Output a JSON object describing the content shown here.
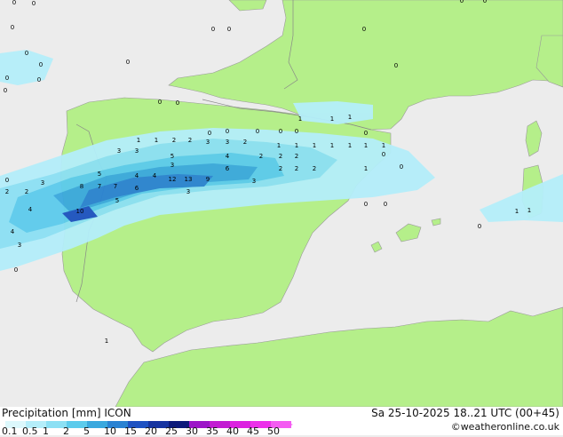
{
  "map": {
    "colors": {
      "sea": "#ececec",
      "land": "#b5ef8a",
      "border": "#999999"
    },
    "precip_labels": [
      "0",
      "0",
      "0",
      "0",
      "0",
      "0",
      "0",
      "0",
      "0",
      "0",
      "0",
      "0",
      "0",
      "0",
      "0",
      "0",
      "0",
      "0",
      "0",
      "0",
      "0",
      "0",
      "0",
      "0",
      "0",
      "0",
      "0",
      "0",
      "0",
      "0",
      "1",
      "1",
      "1",
      "1",
      "1",
      "1",
      "1",
      "1",
      "1",
      "1",
      "1",
      "1",
      "1",
      "1",
      "1",
      "1",
      "2",
      "2",
      "2",
      "2",
      "2",
      "2",
      "2",
      "2",
      "2",
      "2",
      "2",
      "3",
      "3",
      "3",
      "3",
      "3",
      "3",
      "3",
      "3",
      "3",
      "4",
      "4",
      "4",
      "4",
      "4",
      "5",
      "5",
      "5",
      "6",
      "6",
      "7",
      "7",
      "8",
      "9",
      "10",
      "12",
      "13"
    ]
  },
  "footer": {
    "title": "Precipitation [mm]",
    "model": "ICON",
    "datetime": "Sa 25-10-2025 18..21 UTC (00+45)",
    "credit": "©weatheronline.co.uk",
    "scale_labels": [
      "0.1",
      "0.5",
      "1",
      "2",
      "5",
      "10",
      "15",
      "20",
      "25",
      "30",
      "35",
      "40",
      "45",
      "50"
    ],
    "scale_colors": [
      "#dcf8fc",
      "#b4eefa",
      "#8ce0f4",
      "#5ccbec",
      "#3aa8de",
      "#2a82d2",
      "#1e52c2",
      "#1634a0",
      "#0c1a7a",
      "#9c16c8",
      "#c21cd2",
      "#dc22e0",
      "#ec30ea",
      "#f45cf2"
    ]
  }
}
